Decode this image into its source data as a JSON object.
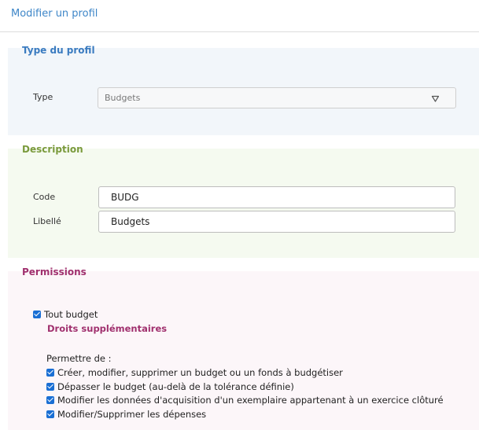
{
  "page": {
    "title": "Modifier un profil"
  },
  "type_section": {
    "legend": "Type du profil",
    "type_label": "Type",
    "type_value": "Budgets",
    "chevron": "chevron-down-icon"
  },
  "description": {
    "legend": "Description",
    "code_label": "Code",
    "code_value": "BUDG",
    "libelle_label": "Libellé",
    "libelle_value": "Budgets"
  },
  "permissions": {
    "legend": "Permissions",
    "tout_budget": {
      "label": "Tout budget",
      "checked": true
    },
    "droits_title": "Droits supplémentaires",
    "permettre_label": "Permettre de :",
    "items": [
      {
        "label": "Créer, modifier, supprimer un budget ou un fonds à budgétiser",
        "checked": true
      },
      {
        "label": "Dépasser le budget (au-delà de la tolérance définie)",
        "checked": true
      },
      {
        "label": "Modifier les données d'acquisition d'un exemplaire appartenant à un exercice clôturé",
        "checked": true
      },
      {
        "label": "Modifier/Supprimer les dépenses",
        "checked": true
      }
    ]
  },
  "colors": {
    "title_blue": "#3e86c8",
    "type_bg": "#f2f6fa",
    "desc_bg": "#f5faf0",
    "perm_bg": "#fcf6f9",
    "desc_green": "#7a9a3c",
    "perm_magenta": "#a0306e",
    "checkbox_blue": "#1a6fd4"
  }
}
